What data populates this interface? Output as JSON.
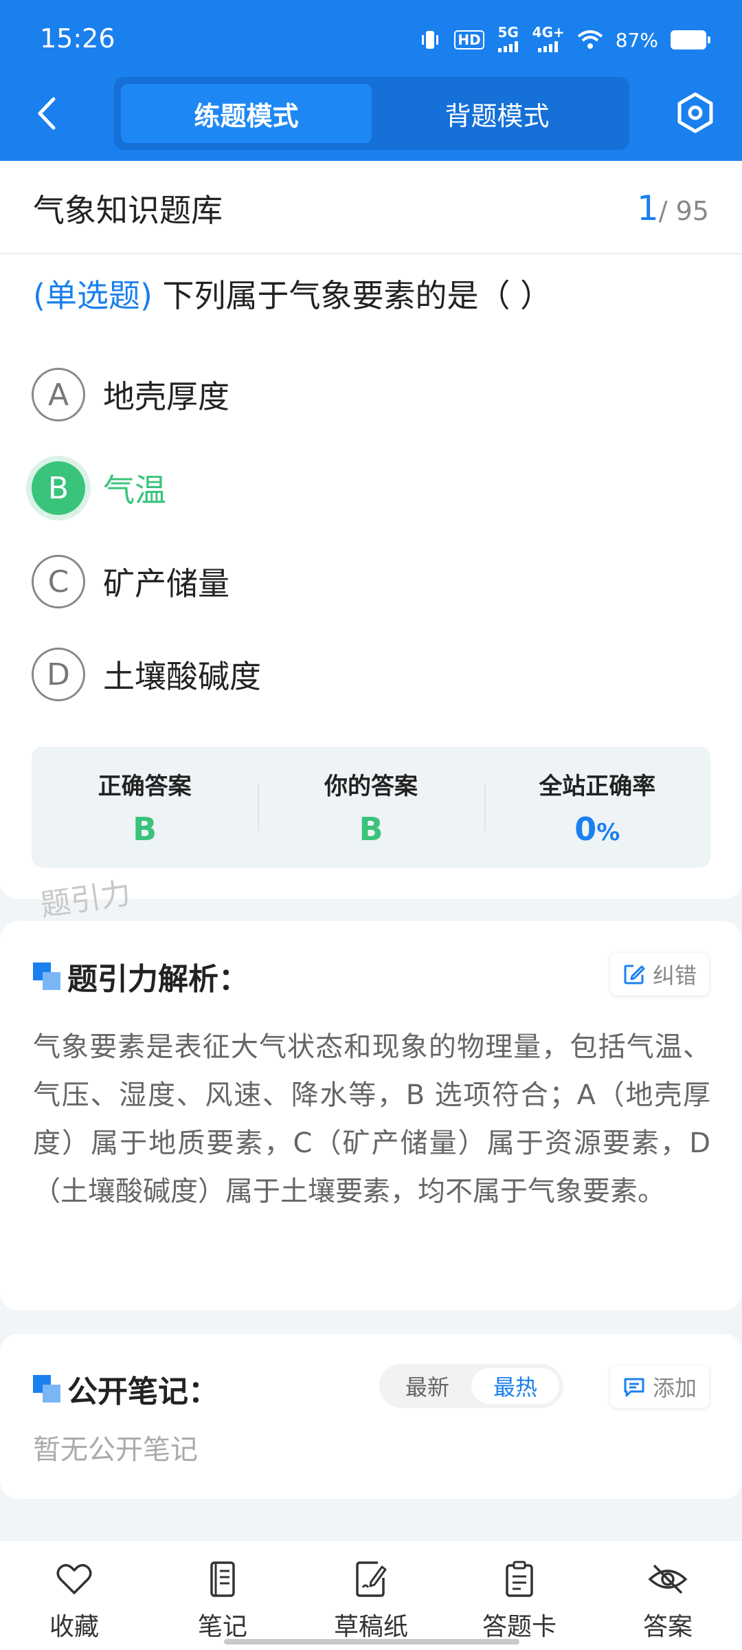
{
  "status_bar": {
    "time": "15:26",
    "hd_label": "HD",
    "net1": "5G",
    "net2": "4G+",
    "battery_text": "87%"
  },
  "mode_tabs": [
    {
      "label": "练题模式",
      "active": true
    },
    {
      "label": "背题模式",
      "active": false
    }
  ],
  "bank": {
    "title": "气象知识题库",
    "current": "1",
    "total": "/ 95"
  },
  "question": {
    "type": "(单选题)",
    "text": " 下列属于气象要素的是（        ）",
    "options": [
      {
        "letter": "A",
        "text": "地壳厚度",
        "selected": false
      },
      {
        "letter": "B",
        "text": "气温",
        "selected": true
      },
      {
        "letter": "C",
        "text": "矿产储量",
        "selected": false
      },
      {
        "letter": "D",
        "text": "土壤酸碱度",
        "selected": false
      }
    ]
  },
  "answer_summary": {
    "correct_label": "正确答案",
    "correct_value": "B",
    "yours_label": "你的答案",
    "yours_value": "B",
    "rate_label": "全站正确率",
    "rate_value": "0",
    "rate_unit": "%"
  },
  "watermark": "题引力",
  "analysis": {
    "title": "题引力解析：",
    "report_label": "纠错",
    "text": "气象要素是表征大气状态和现象的物理量，包括气温、气压、湿度、风速、降水等，B 选项符合；A（地壳厚度）属于地质要素，C（矿产储量）属于资源要素，D（土壤酸碱度）属于土壤要素，均不属于气象要素。"
  },
  "notes": {
    "title": "公开笔记：",
    "sort_newest": "最新",
    "sort_hottest": "最热",
    "add_label": "添加",
    "empty_text": "暂无公开笔记"
  },
  "bottom_nav": [
    {
      "label": "收藏",
      "icon": "heart-icon"
    },
    {
      "label": "笔记",
      "icon": "notebook-icon"
    },
    {
      "label": "草稿纸",
      "icon": "draft-paper-icon"
    },
    {
      "label": "答题卡",
      "icon": "answer-card-icon"
    },
    {
      "label": "答案",
      "icon": "eye-off-icon"
    }
  ],
  "colors": {
    "primary": "#1a80ee",
    "correct": "#3ac37b",
    "header_bg": "#1a80ee"
  }
}
